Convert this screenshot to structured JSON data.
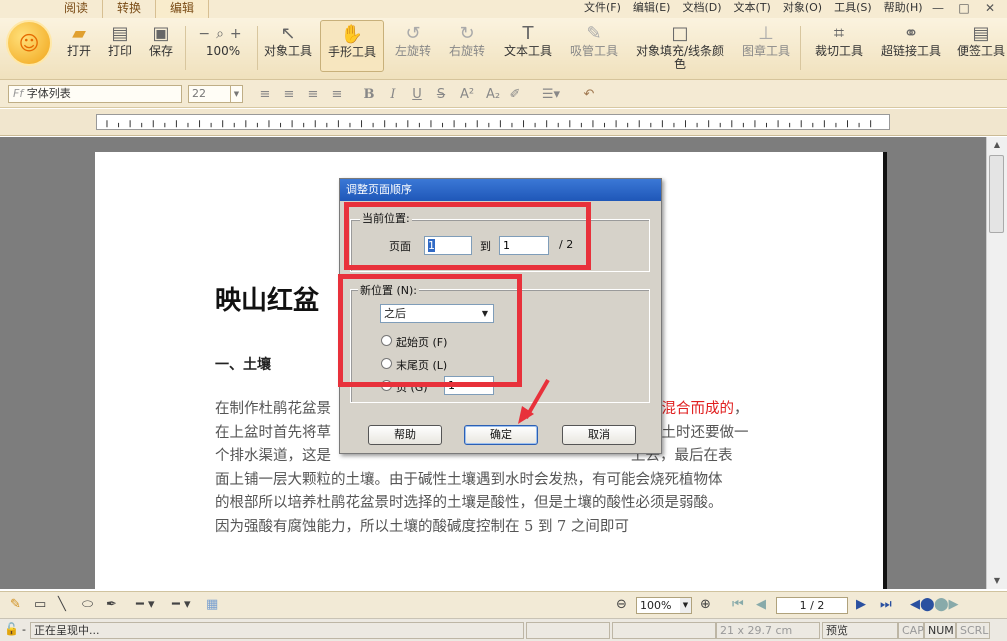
{
  "top_tabs": [
    "阅读",
    "转换",
    "编辑"
  ],
  "menus": [
    "文件(F)",
    "编辑(E)",
    "文档(D)",
    "文本(T)",
    "对象(O)",
    "工具(S)",
    "帮助(H)"
  ],
  "window_buttons": [
    "—",
    "□",
    "✕"
  ],
  "toolbar": {
    "open": "打开",
    "print": "打印",
    "save": "保存",
    "zoom": "100%",
    "object_tool": "对象工具",
    "hand_tool": "手形工具",
    "rotate_left": "左旋转",
    "rotate_right": "右旋转",
    "text_tool": "文本工具",
    "eyedropper_tool": "吸管工具",
    "fill_stroke": "对象填充/线条颜色",
    "stamp_tool": "图章工具",
    "crop_tool": "裁切工具",
    "hyperlink_tool": "超链接工具",
    "note_tool": "便签工具"
  },
  "format_bar": {
    "font_list": "字体列表",
    "font_size": "22",
    "buttons": [
      "B",
      "I",
      "U",
      "S",
      "A²",
      "A₂"
    ]
  },
  "document": {
    "title": "映山红盆",
    "heading": "一、土壤",
    "para_line1_pre": "在制作杜鹃花盆景",
    "para_line1_red": "等混合而成的",
    "para_line1_end": "，",
    "para_line2_pre": "在上盆时首先将草",
    "para_line2_end": "填土时还要做一",
    "para_line3_pre": "个排水渠道，这是",
    "para_line3_end": "上去，最后在表",
    "para_lines": [
      "面上铺一层大颗粒的土壤。由于碱性土壤遇到水时会发热，有可能会烧死植物体",
      "的根部所以培养杜鹃花盆景时选择的土壤是酸性，但是土壤的酸性必须是弱酸。",
      "因为强酸有腐蚀能力，所以土壤的酸碱度控制在 5 到 7 之间即可"
    ]
  },
  "dialog": {
    "title": "调整页面顺序",
    "current_group": "当前位置:",
    "page_label": "页面",
    "from_value": "1",
    "to_label": "到",
    "to_value": "1",
    "total": "/  2",
    "new_group": "新位置 (N):",
    "position_select": "之后",
    "radio_first": "起始页 (F)",
    "radio_last": "末尾页 (L)",
    "radio_page": "页 (G)",
    "page_value": "1",
    "help": "帮助",
    "ok": "确定",
    "cancel": "取消"
  },
  "bottom": {
    "zoom": "100%",
    "page_indicator": "1 / 2"
  },
  "status": {
    "dash": "-",
    "message": "正在呈现中...",
    "size": "21 x 29.7 cm",
    "mode": "预览",
    "cap": "CAP",
    "num": "NUM",
    "scrl": "SCRL"
  },
  "colors": {
    "highlight": "#e8313b",
    "accent": "#f1a51a",
    "red_text": "#e02020"
  }
}
